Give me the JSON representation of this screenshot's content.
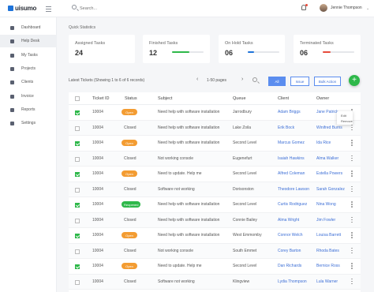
{
  "header": {
    "logo_text": "uisumo",
    "search_placeholder": "Search...",
    "user_name": "Jennie Thompson",
    "caret": "⌄"
  },
  "sidebar": {
    "items": [
      {
        "label": "Dashboard",
        "icon": "dashboard-icon"
      },
      {
        "label": "Help Desk",
        "icon": "help-desk-icon",
        "active": true
      },
      {
        "label": "My Tasks",
        "icon": "tasks-icon"
      },
      {
        "label": "Projects",
        "icon": "projects-icon"
      },
      {
        "label": "Clients",
        "icon": "clients-icon"
      },
      {
        "label": "Invoice",
        "icon": "invoice-icon"
      },
      {
        "label": "Reports",
        "icon": "reports-icon"
      },
      {
        "label": "Settings",
        "icon": "settings-icon"
      }
    ]
  },
  "main": {
    "section_title": "Quick Statistics",
    "stats": [
      {
        "title": "Assigned Tasks",
        "value": "24"
      },
      {
        "title": "Finished Tasks",
        "value": "12",
        "progress": 0.55,
        "color": "#2eb84a"
      },
      {
        "title": "On Hold Tasks",
        "value": "06",
        "progress": 0.2,
        "color": "#1e73d9"
      },
      {
        "title": "Terminated Tasks",
        "value": "06",
        "progress": 0.25,
        "color": "#e74c3c"
      }
    ],
    "tickets_label": "Latest Tickets (Showing 1 to 6 of 6 records)",
    "pagination": {
      "prev": "‹",
      "label": "1-50 pages",
      "next": "›"
    },
    "filters": [
      "All",
      "Issue",
      "Bulk Action"
    ],
    "fab": "+",
    "columns": [
      "Ticket ID",
      "Status",
      "Subject",
      "Queue",
      "Client",
      "Owner"
    ],
    "popup": [
      "Edit",
      "Remove"
    ],
    "status_colors": {
      "Open": "#f39c32",
      "Reopened": "#2eb84a"
    },
    "rows": [
      {
        "checked": true,
        "id": "10004",
        "status": "Open",
        "badge": true,
        "subject": "Need help with software installation",
        "queue": "Jarrodbury",
        "client": "Adam Briggs",
        "owner": "Jane Patrick"
      },
      {
        "checked": false,
        "id": "10004",
        "status": "Closed",
        "badge": false,
        "subject": "Need help with software installation",
        "queue": "Lake Zoila",
        "client": "Erik Bock",
        "owner": "Winifred Burns"
      },
      {
        "checked": true,
        "id": "10004",
        "status": "Open",
        "badge": true,
        "subject": "Need help with software installation",
        "queue": "Second Level",
        "client": "Marcus Gomez",
        "owner": "Ida Rice"
      },
      {
        "checked": false,
        "id": "10004",
        "status": "Closed",
        "badge": false,
        "subject": "Not working console",
        "queue": "Eugenefurt",
        "client": "Isaiah Hawkins",
        "owner": "Alma Walker"
      },
      {
        "checked": true,
        "id": "10004",
        "status": "Open",
        "badge": true,
        "subject": "Need to update. Help me",
        "queue": "Second Level",
        "client": "Alfred Coleman",
        "owner": "Estella Powers"
      },
      {
        "checked": false,
        "id": "10004",
        "status": "Closed",
        "badge": false,
        "subject": "Software not working",
        "queue": "Dorisonston",
        "client": "Theodore Lawson",
        "owner": "Sarah Gonzalez"
      },
      {
        "checked": true,
        "id": "10004",
        "status": "Reopened",
        "badge": true,
        "subject": "Need help with software installation",
        "queue": "Second Level",
        "client": "Curtis Rodriguez",
        "owner": "Nina Wong"
      },
      {
        "checked": false,
        "id": "10004",
        "status": "Closed",
        "badge": false,
        "subject": "Need help with software installation",
        "queue": "Connie Bailey",
        "client": "Alma Wright",
        "owner": "Jim Fowler"
      },
      {
        "checked": true,
        "id": "10004",
        "status": "Open",
        "badge": true,
        "subject": "Need help with software installation",
        "queue": "West Emmomby",
        "client": "Connor Welch",
        "owner": "Louisa Barrett"
      },
      {
        "checked": false,
        "id": "10004",
        "status": "Closed",
        "badge": false,
        "subject": "Not working console",
        "queue": "South Emmet",
        "client": "Corey Barton",
        "owner": "Rhoda Bates"
      },
      {
        "checked": true,
        "id": "10004",
        "status": "Open",
        "badge": true,
        "subject": "Need to update. Help me",
        "queue": "Second Level",
        "client": "Dan Richards",
        "owner": "Bernice Ross"
      },
      {
        "checked": false,
        "id": "10004",
        "status": "Closed",
        "badge": false,
        "subject": "Software not working",
        "queue": "Klingview",
        "client": "Lydia Thompson",
        "owner": "Lula Warner"
      }
    ]
  }
}
